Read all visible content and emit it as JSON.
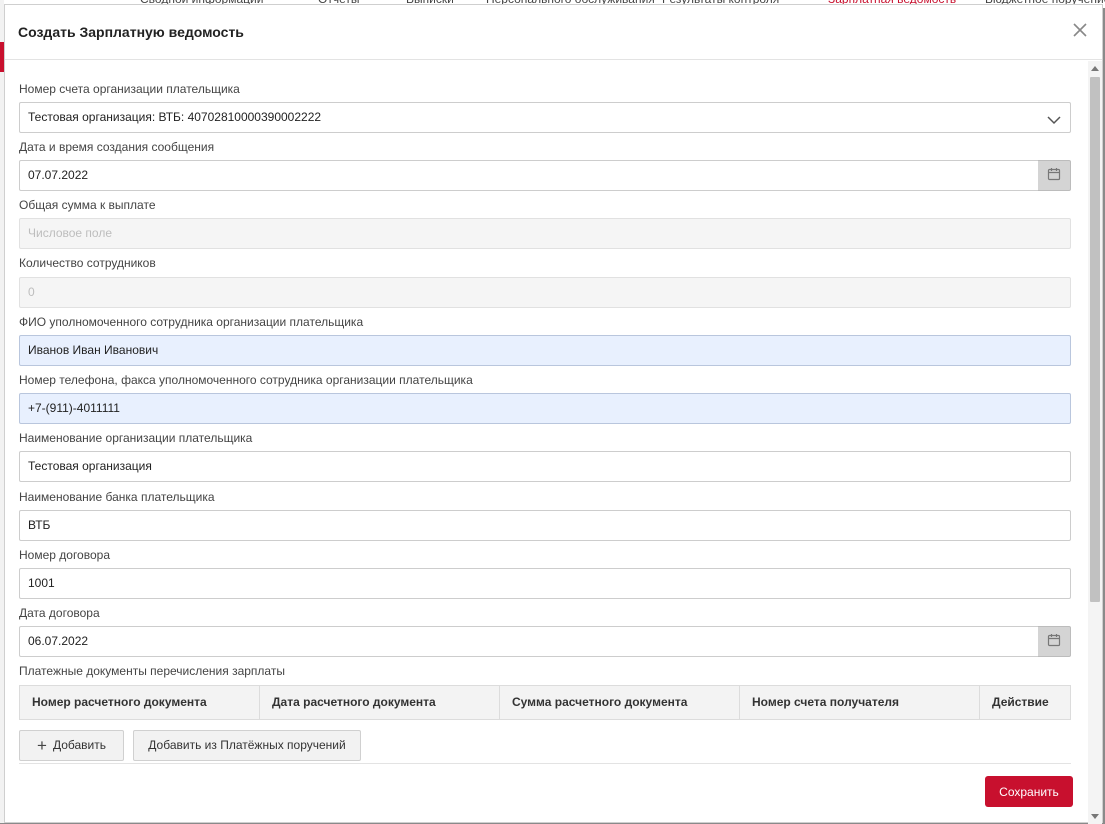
{
  "dialog": {
    "title": "Создать Зарплатную ведомость"
  },
  "fields": {
    "payer_account": {
      "label": "Номер счета организации плательщика",
      "value": "Тестовая организация: ВТБ: 40702810000390002222"
    },
    "message_date": {
      "label": "Дата и время создания сообщения",
      "value": "07.07.2022"
    },
    "total_amount": {
      "label": "Общая сумма к выплате",
      "placeholder": "Числовое поле"
    },
    "employee_count": {
      "label": "Количество сотрудников",
      "value": "0"
    },
    "authorized_person": {
      "label": "ФИО уполномоченного сотрудника организации плательщика",
      "value": "Иванов Иван Иванович"
    },
    "phone": {
      "label": "Номер телефона, факса уполномоченного сотрудника организации плательщика",
      "value": "+7-(911)-4011111"
    },
    "org_name": {
      "label": "Наименование организации плательщика",
      "value": "Тестовая организация"
    },
    "bank_name": {
      "label": "Наименование банка плательщика",
      "value": "ВТБ"
    },
    "contract_number": {
      "label": "Номер договора",
      "value": "1001"
    },
    "contract_date": {
      "label": "Дата договора",
      "value": "06.07.2022"
    }
  },
  "payments_table": {
    "label": "Платежные документы перечисления зарплаты",
    "columns": [
      "Номер расчетного документа",
      "Дата расчетного документа",
      "Сумма расчетного документа",
      "Номер счета получателя",
      "Действие"
    ],
    "rows": []
  },
  "buttons": {
    "add": "Добавить",
    "add_from_orders": "Добавить из Платёжных поручений",
    "save": "Сохранить"
  },
  "colors": {
    "accent": "#c8102e",
    "highlight_field": "#e8f0fe"
  }
}
